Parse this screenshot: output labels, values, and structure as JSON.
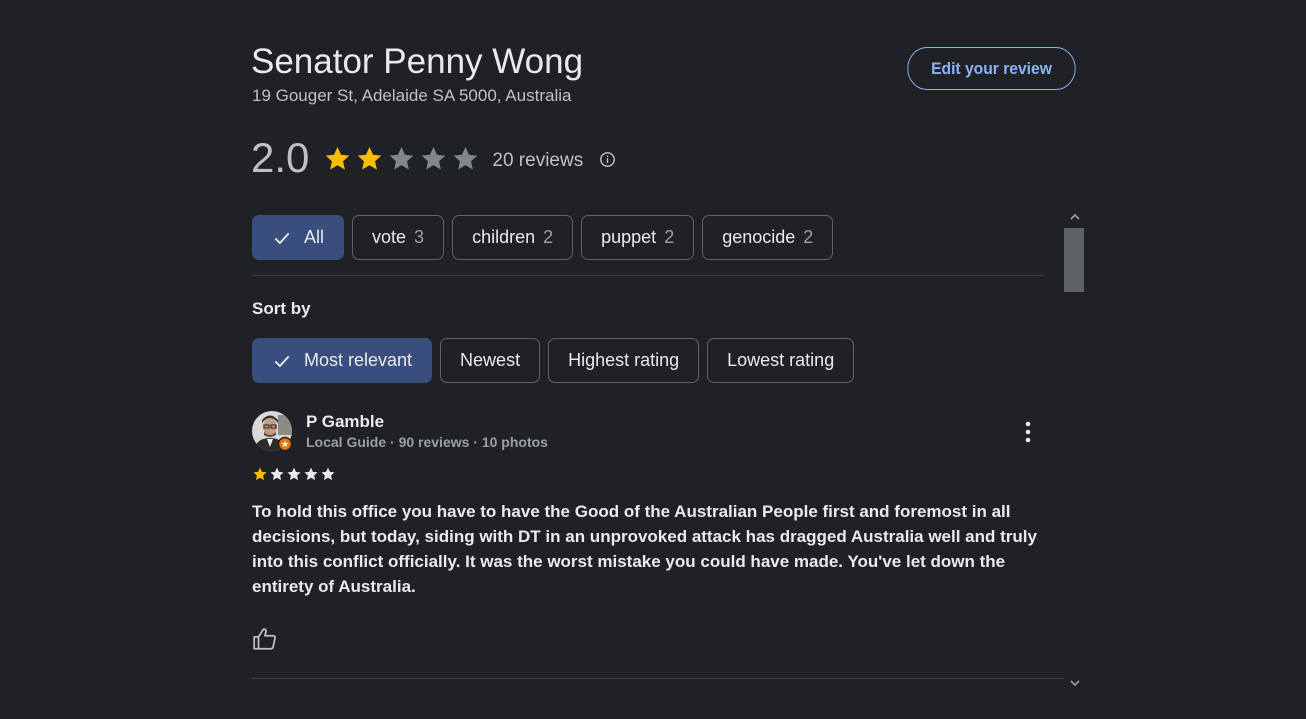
{
  "place": {
    "name": "Senator Penny Wong",
    "address": "19 Gouger St, Adelaide SA 5000, Australia"
  },
  "actions": {
    "edit_review": "Edit your review"
  },
  "rating": {
    "value": "2.0",
    "stars_filled": 2,
    "stars_total": 5,
    "count_text": "20 reviews",
    "star_color": "#fbbc04",
    "star_empty_color": "#80868b"
  },
  "topics": [
    {
      "label": "All",
      "count": "",
      "selected": true
    },
    {
      "label": "vote",
      "count": "3",
      "selected": false
    },
    {
      "label": "children",
      "count": "2",
      "selected": false
    },
    {
      "label": "puppet",
      "count": "2",
      "selected": false
    },
    {
      "label": "genocide",
      "count": "2",
      "selected": false
    }
  ],
  "sort": {
    "label": "Sort by",
    "options": [
      {
        "label": "Most relevant",
        "selected": true
      },
      {
        "label": "Newest",
        "selected": false
      },
      {
        "label": "Highest rating",
        "selected": false
      },
      {
        "label": "Lowest rating",
        "selected": false
      }
    ]
  },
  "review": {
    "author": "P Gamble",
    "meta": "Local Guide · 90 reviews · 10 photos",
    "stars_filled": 1,
    "text": "To hold this office you have to have the Good of the Australian People first and foremost in all decisions, but today, siding with DT in an unprovoked attack has dragged Australia well and truly into this conflict officially. It was the worst mistake you could have made. You've let down the entirety of Australia."
  },
  "colors": {
    "background": "#202124",
    "accent": "#8ab4f8",
    "chip_selected": "#394e7d",
    "local_guide_badge": "#e8710a"
  }
}
